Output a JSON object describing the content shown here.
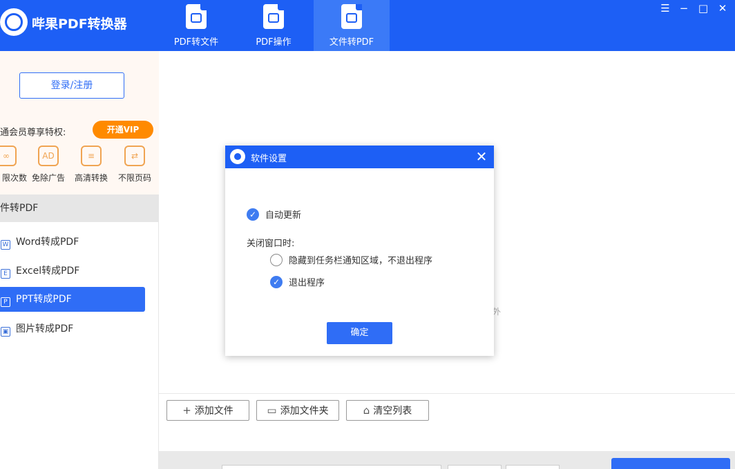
{
  "app": {
    "title": "哔果PDF转换器",
    "brand_color": "#1d5ff5",
    "logo_icon": "strawberry-logo-icon"
  },
  "header": {
    "tabs": [
      {
        "label": "PDF转文件",
        "icon": "pdf-file-icon",
        "active": false
      },
      {
        "label": "PDF操作",
        "icon": "pdf-edit-icon",
        "active": false
      },
      {
        "label": "文件转PDF",
        "icon": "convert-to-pdf-icon",
        "active": true
      }
    ],
    "window_controls": [
      "menu-icon",
      "minimize-icon",
      "maximize-icon",
      "close-icon"
    ]
  },
  "sidebar": {
    "login_label": "登录/注册",
    "privilege_label": "通会员尊享特权:",
    "vip_label": "开通VIP",
    "vip_color": "#ff8a00",
    "privileges": [
      {
        "label": "限次数",
        "icon": "infinity-icon",
        "glyph": "∞"
      },
      {
        "label": "免除广告",
        "icon": "no-ad-icon",
        "glyph": "AD"
      },
      {
        "label": "高清转换",
        "icon": "hd-convert-icon",
        "glyph": "≡"
      },
      {
        "label": "不限页码",
        "icon": "unlimited-pages-icon",
        "glyph": "⇄"
      }
    ],
    "section_title": "件转PDF",
    "items": [
      {
        "label": "Word转成PDF",
        "icon": "word-icon",
        "glyph": "W",
        "active": false
      },
      {
        "label": "Excel转成PDF",
        "icon": "excel-icon",
        "glyph": "E",
        "active": false
      },
      {
        "label": "PPT转成PDF",
        "icon": "ppt-icon",
        "glyph": "P",
        "active": true
      },
      {
        "label": "图片转成PDF",
        "icon": "image-icon",
        "glyph": "▣",
        "active": false
      }
    ]
  },
  "main": {
    "faint_text": "外",
    "toolbar": {
      "add_file": "添加文件",
      "add_folder": "添加文件夹",
      "clear_list": "清空列表"
    }
  },
  "dialog": {
    "title": "软件设置",
    "auto_update_label": "自动更新",
    "auto_update_checked": true,
    "close_window_label": "关闭窗口时:",
    "option_hide_label": "隐藏到任务栏通知区域，不退出程序",
    "option_hide_selected": false,
    "option_exit_label": "退出程序",
    "option_exit_selected": true,
    "ok_label": "确定",
    "header_color": "#1d5ff5"
  }
}
